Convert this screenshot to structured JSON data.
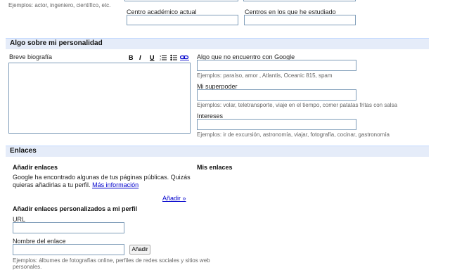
{
  "top": {
    "examples_occupation": "Ejemplos: actor, ingeniero, científico, etc.",
    "current_school_label": "Centro académico actual",
    "past_schools_label": "Centros en los que he estudiado"
  },
  "personality": {
    "section_title": "Algo sobre mi personalidad",
    "bio_label": "Breve biografía",
    "toolbar": {
      "bold": "B",
      "italic": "I",
      "underline": "U"
    },
    "cant_find_label": "Algo que no encuentro con Google",
    "cant_find_examples": "Ejemplos: paraíso, amor , Atlantis, Oceanic 815, spam",
    "superpower_label": "Mi superpoder",
    "superpower_examples": "Ejemplos: volar, teletransporte, viaje en el tiempo, comer patatas fritas con salsa",
    "interests_label": "Intereses",
    "interests_examples": "Ejemplos: ir de excursión, astronomía, viajar, fotografía, cocinar, gastronomía"
  },
  "links": {
    "section_title": "Enlaces",
    "add_links_title": "Añadir enlaces",
    "add_links_text_1": "Google ha encontrado algunas de tus páginas públicas. Quizás",
    "add_links_text_2": "quieras añadirlas a tu perfil.",
    "more_info_link": "Más información",
    "add_link": "Añadir »",
    "my_links_title": "Mis enlaces",
    "custom_links_title": "Añadir enlaces personalizados a mi perfil",
    "url_label": "URL",
    "link_name_label": "Nombre del enlace",
    "add_button": "Añadir",
    "examples_1": "Ejemplos: álbumes de fotografías online, perfiles de redes sociales y sitios web",
    "examples_2": "personales."
  }
}
